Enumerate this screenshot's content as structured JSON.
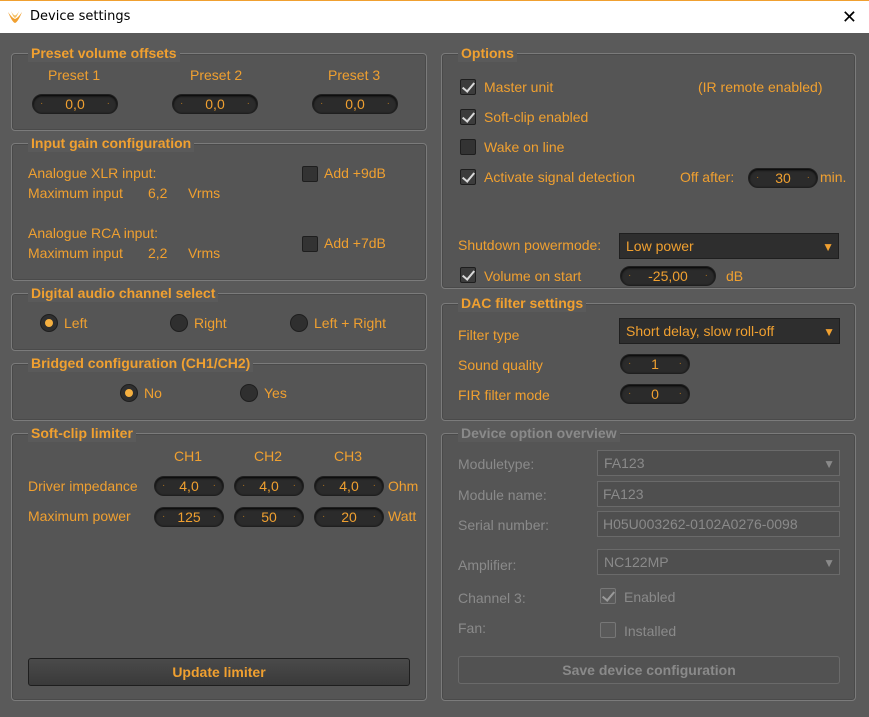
{
  "window": {
    "title": "Device settings",
    "close_glyph": "✕",
    "icon": "app-logo-icon"
  },
  "preset": {
    "legend": "Preset volume offsets",
    "labels": [
      "Preset 1",
      "Preset 2",
      "Preset 3"
    ],
    "values": [
      "0,0",
      "0,0",
      "0,0"
    ]
  },
  "input_gain": {
    "legend": "Input gain configuration",
    "xlr_label": "Analogue XLR input:",
    "xlr_max_label": "Maximum input",
    "xlr_max_value": "6,2",
    "xlr_unit": "Vrms",
    "xlr_add": "Add +9dB",
    "rca_label": "Analogue RCA input:",
    "rca_max_label": "Maximum input",
    "rca_max_value": "2,2",
    "rca_unit": "Vrms",
    "rca_add": "Add +7dB"
  },
  "digital": {
    "legend": "Digital audio channel select",
    "options": [
      "Left",
      "Right",
      "Left + Right"
    ],
    "selected": "Left"
  },
  "bridged": {
    "legend": "Bridged configuration (CH1/CH2)",
    "options": [
      "No",
      "Yes"
    ],
    "selected": "No"
  },
  "softclip": {
    "legend": "Soft-clip limiter",
    "channels": [
      "CH1",
      "CH2",
      "CH3"
    ],
    "impedance_label": "Driver impedance",
    "impedance": [
      "4,0",
      "4,0",
      "4,0"
    ],
    "impedance_unit": "Ohm",
    "power_label": "Maximum power",
    "power": [
      "125",
      "50",
      "20"
    ],
    "power_unit": "Watt",
    "update_button": "Update limiter"
  },
  "options": {
    "legend": "Options",
    "master_unit": "Master unit",
    "ir_remote": "(IR remote enabled)",
    "softclip_enabled": "Soft-clip enabled",
    "wake_on_line": "Wake on line",
    "signal_detection": "Activate signal detection",
    "off_after_label": "Off after:",
    "off_after_value": "30",
    "off_after_unit": "min.",
    "shutdown_label": "Shutdown powermode:",
    "shutdown_value": "Low power",
    "volume_on_start": "Volume on start",
    "volume_value": "-25,00",
    "volume_unit": "dB"
  },
  "dac": {
    "legend": "DAC filter settings",
    "filter_type_label": "Filter type",
    "filter_type_value": "Short delay, slow roll-off",
    "sound_quality_label": "Sound quality",
    "sound_quality_value": "1",
    "fir_label": "FIR filter mode",
    "fir_value": "0"
  },
  "overview": {
    "legend": "Device option overview",
    "moduletype_label": "Moduletype:",
    "moduletype_value": "FA123",
    "module_name_label": "Module name:",
    "module_name_value": "FA123",
    "serial_label": "Serial number:",
    "serial_value": "H05U003262-0102A0276-0098",
    "amplifier_label": "Amplifier:",
    "amplifier_value": "NC122MP",
    "channel3_label": "Channel 3:",
    "channel3_check": "Enabled",
    "fan_label": "Fan:",
    "fan_check": "Installed",
    "save_button": "Save device configuration"
  },
  "colors": {
    "accent": "#f0a030",
    "background": "#5a5a5a",
    "disabled": "#8a8a8a"
  }
}
